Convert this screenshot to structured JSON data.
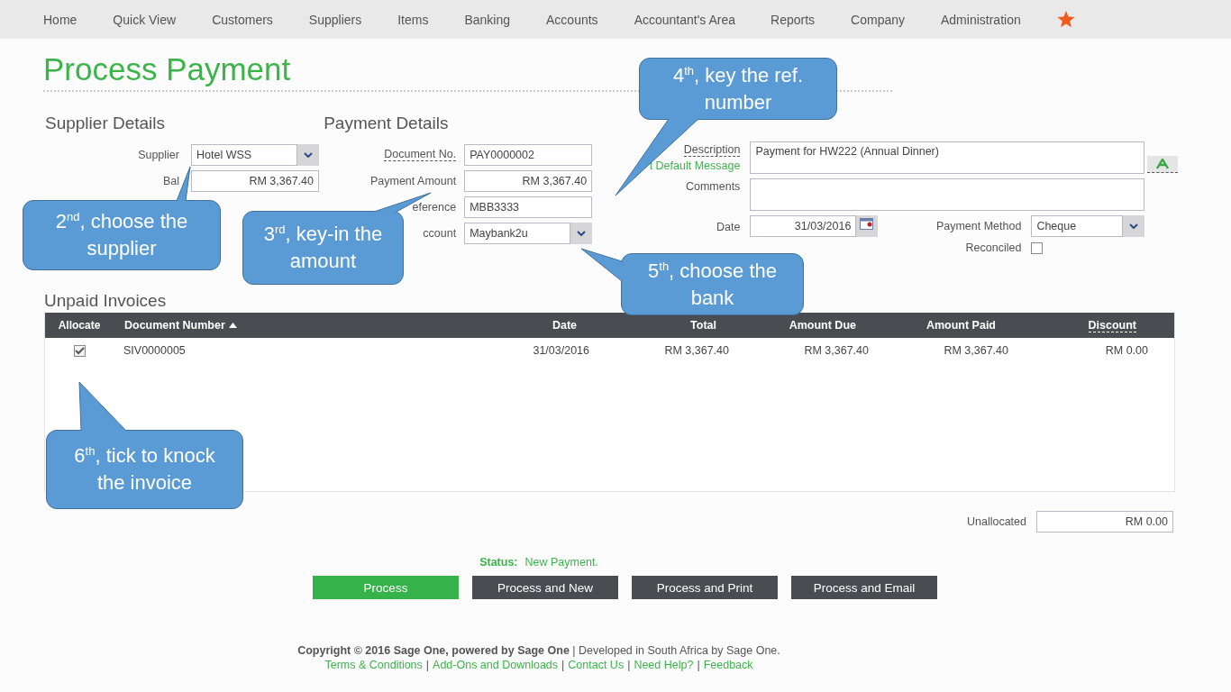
{
  "nav": {
    "items": [
      "Home",
      "Quick View",
      "Customers",
      "Suppliers",
      "Items",
      "Banking",
      "Accounts",
      "Accountant's Area",
      "Reports",
      "Company",
      "Administration"
    ]
  },
  "page_title": "Process Payment",
  "supplier_details": {
    "heading": "Supplier Details",
    "fields": [
      {
        "label": "Supplier",
        "value": "Hotel WSS",
        "kind": "dropdown",
        "has_tooltip": false
      },
      {
        "label": "Bal",
        "value": "RM 3,367.40",
        "kind": "amount",
        "has_tooltip": false
      }
    ]
  },
  "payment_details": {
    "heading": "Payment Details",
    "fields": [
      {
        "label": "Document No.",
        "value": "PAY0000002",
        "kind": "text",
        "has_tooltip": true
      },
      {
        "label": "Payment Amount",
        "value": "RM 3,367.40",
        "kind": "amount",
        "has_tooltip": false
      },
      {
        "label": "eference",
        "value": "MBB3333",
        "kind": "text",
        "has_tooltip": false
      },
      {
        "label": "ccount",
        "value": "Maybank2u",
        "kind": "dropdown",
        "has_tooltip": false
      }
    ]
  },
  "description": {
    "label": "Description",
    "value": "Payment for HW222 (Annual Dinner)",
    "link": "t Default Message"
  },
  "comments": {
    "label": "Comments"
  },
  "date": {
    "label": "Date",
    "value": "31/03/2016"
  },
  "payment_method": {
    "label": "Payment Method",
    "value": "Cheque"
  },
  "reconciled": {
    "label": "Reconciled",
    "checked": false
  },
  "unpaid_invoices": {
    "heading": "Unpaid Invoices",
    "allocate_header": "Allocate",
    "columns": [
      {
        "label": "Document Number",
        "sorted": true,
        "has_tooltip": false
      },
      {
        "label": "Date",
        "sorted": false,
        "has_tooltip": false
      },
      {
        "label": "Total",
        "sorted": false,
        "has_tooltip": false
      },
      {
        "label": "Amount Due",
        "sorted": false,
        "has_tooltip": false
      },
      {
        "label": "Amount Paid",
        "sorted": false,
        "has_tooltip": false
      },
      {
        "label": "Discount",
        "sorted": false,
        "has_tooltip": true
      }
    ],
    "rows": [
      {
        "allocate": true,
        "cells": [
          "SIV0000005",
          "31/03/2016",
          "RM 3,367.40",
          "RM 3,367.40",
          "RM 3,367.40",
          "RM 0.00"
        ]
      }
    ]
  },
  "unallocated": {
    "label": "Unallocated",
    "value": "RM 0.00"
  },
  "status": {
    "label": "Status:",
    "value": "New Payment."
  },
  "buttons": [
    {
      "label": "Process",
      "primary": true
    },
    {
      "label": "Process and New",
      "primary": false
    },
    {
      "label": "Process and Print",
      "primary": false
    },
    {
      "label": "Process and Email",
      "primary": false
    }
  ],
  "footer": {
    "copyright": "**Copyright © 2016 Sage One, powered by Sage One** | Developed in South Africa by Sage One.",
    "separator": "|",
    "links": [
      "Terms & Conditions",
      "Add-Ons and Downloads",
      "Contact Us",
      "Need Help?",
      "Feedback"
    ]
  },
  "callouts": [
    {
      "text": "2$^{nd}$, choose the supplier"
    },
    {
      "text": "3$^{rd}$, key-in the amount"
    },
    {
      "text": "4$^{th}$, key the ref. number"
    },
    {
      "text": "5$^{th}$, choose the bank"
    },
    {
      "text": "6$^{th}$, tick to knock the invoice"
    }
  ]
}
